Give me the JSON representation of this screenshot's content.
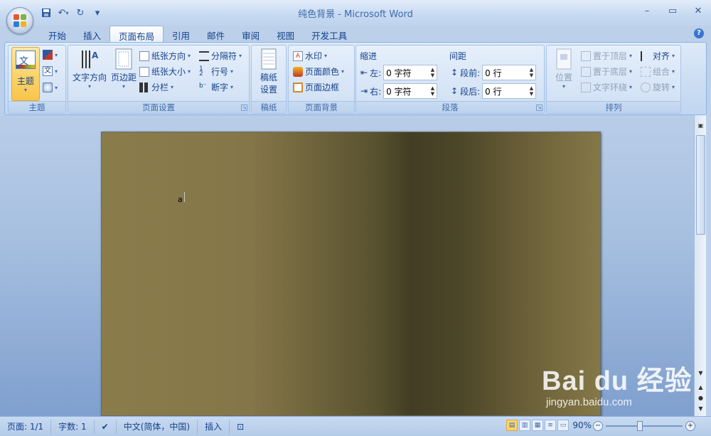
{
  "window": {
    "title": "纯色背景 - Microsoft Word"
  },
  "quick_access": {
    "save": "save-icon",
    "undo": "undo-icon",
    "redo": "redo-icon",
    "customize": "▾"
  },
  "tabs": [
    {
      "label": "开始"
    },
    {
      "label": "插入"
    },
    {
      "label": "页面布局"
    },
    {
      "label": "引用"
    },
    {
      "label": "邮件"
    },
    {
      "label": "审阅"
    },
    {
      "label": "视图"
    },
    {
      "label": "开发工具"
    }
  ],
  "ribbon": {
    "theme_group": {
      "label": "主题",
      "theme_button": "主题"
    },
    "page_setup": {
      "label": "页面设置",
      "text_direction": "文字方向",
      "margins": "页边距",
      "orientation": "纸张方向",
      "size": "纸张大小",
      "columns": "分栏",
      "breaks": "分隔符",
      "line_numbers": "行号",
      "hyphenation": "断字"
    },
    "draft_paper": {
      "label": "稿纸",
      "button": "稿纸\n设置",
      "line1": "稿纸",
      "line2": "设置"
    },
    "page_background": {
      "label": "页面背景",
      "watermark": "水印",
      "page_color": "页面颜色",
      "page_borders": "页面边框"
    },
    "paragraph": {
      "label": "段落",
      "indent_title": "缩进",
      "spacing_title": "间距",
      "left_label": "左:",
      "left_value": "0 字符",
      "right_label": "右:",
      "right_value": "0 字符",
      "before_label": "段前:",
      "before_value": "0 行",
      "after_label": "段后:",
      "after_value": "0 行"
    },
    "arrange": {
      "label": "排列",
      "position": "位置",
      "bring_front": "置于顶层",
      "send_back": "置于底层",
      "text_wrap": "文字环绕",
      "align": "对齐",
      "group": "组合",
      "rotate": "旋转"
    }
  },
  "document": {
    "text": "a",
    "background_color": "#5a5230"
  },
  "status": {
    "page": "页面: 1/1",
    "words": "字数: 1",
    "language": "中文(简体，中国)",
    "mode": "插入",
    "zoom": "90%",
    "zoom_level_percent": 90
  },
  "watermark": {
    "main": "Bai du 经验",
    "sub": "jingyan.baidu.com"
  }
}
